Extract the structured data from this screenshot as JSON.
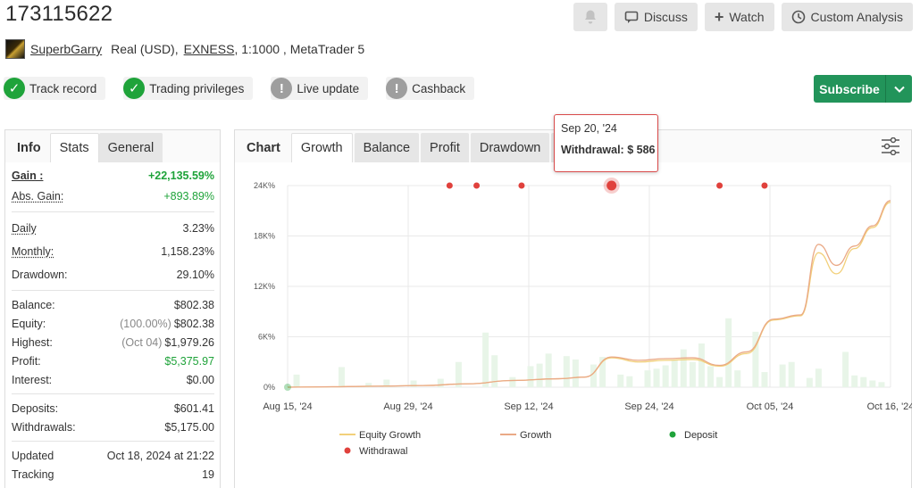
{
  "account": {
    "id": "173115622",
    "owner": "SuperbGarry",
    "type": "Real (USD),",
    "broker": "EXNESS",
    "details": ", 1:1000 , MetaTrader 5"
  },
  "actions": {
    "discuss": "Discuss",
    "watch": "Watch",
    "custom_analysis": "Custom Analysis"
  },
  "badges": [
    {
      "label": "Track record",
      "status": "ok"
    },
    {
      "label": "Trading privileges",
      "status": "ok"
    },
    {
      "label": "Live update",
      "status": "warn"
    },
    {
      "label": "Cashback",
      "status": "warn"
    }
  ],
  "subscribe": {
    "label": "Subscribe"
  },
  "left_tabs": {
    "title": "Info",
    "stats": "Stats",
    "general": "General"
  },
  "stats": {
    "gain": {
      "label": "Gain :",
      "value": "+22,135.59%"
    },
    "abs_gain": {
      "label": "Abs. Gain:",
      "value": "+893.89%"
    },
    "daily": {
      "label": "Daily",
      "value": "3.23%"
    },
    "monthly": {
      "label": "Monthly:",
      "value": "1,158.23%"
    },
    "drawdown": {
      "label": "Drawdown:",
      "value": "29.10%"
    },
    "balance": {
      "label": "Balance:",
      "value": "$802.38"
    },
    "equity": {
      "label": "Equity:",
      "pct": "(100.00%)",
      "value": "$802.38"
    },
    "highest": {
      "label": "Highest:",
      "date": "(Oct 04)",
      "value": "$1,979.26"
    },
    "profit": {
      "label": "Profit:",
      "value": "$5,375.97"
    },
    "interest": {
      "label": "Interest:",
      "value": "$0.00"
    },
    "deposits": {
      "label": "Deposits:",
      "value": "$601.41"
    },
    "withdrawals": {
      "label": "Withdrawals:",
      "value": "$5,175.00"
    },
    "updated": {
      "label": "Updated",
      "value": "Oct 18, 2024 at 21:22"
    },
    "tracking": {
      "label": "Tracking",
      "value": "19"
    }
  },
  "chart_tabs": {
    "title": "Chart",
    "items": [
      "Growth",
      "Balance",
      "Profit",
      "Drawdown"
    ]
  },
  "tooltip": {
    "date": "Sep 20, '24",
    "label": "Withdrawal:",
    "value": "$ 586"
  },
  "colors": {
    "gain_green": "#1fa33a",
    "subscribe": "#22945a",
    "withdrawal": "#e0413c",
    "deposit": "#1fa33a",
    "equity_line": "#f2d07a",
    "growth_line": "#eaa986",
    "bars": "#e8f5e8"
  },
  "chart_data": {
    "type": "line",
    "x_ticks": [
      "Aug 15, '24",
      "Aug 29, '24",
      "Sep 12, '24",
      "Sep 24, '24",
      "Oct 05, '24",
      "Oct 16, '24"
    ],
    "y_ticks": [
      "0%",
      "6K%",
      "12K%",
      "18K%",
      "24K%"
    ],
    "ylim": [
      0,
      24000
    ],
    "xlim_days": [
      0,
      67
    ],
    "grid": true,
    "legend_position": "bottom",
    "series": [
      {
        "name": "Equity Growth",
        "type": "line",
        "x": [
          0,
          5,
          10,
          15,
          20,
          25,
          30,
          33,
          36,
          39,
          42,
          45,
          48,
          51,
          54,
          57,
          59,
          61,
          63,
          65,
          67
        ],
        "values": [
          0,
          50,
          120,
          200,
          400,
          800,
          1000,
          1200,
          3500,
          3000,
          3200,
          3300,
          2500,
          4000,
          8000,
          8500,
          16000,
          13500,
          16500,
          19000,
          22000
        ]
      },
      {
        "name": "Growth",
        "type": "line",
        "x": [
          0,
          5,
          10,
          15,
          20,
          25,
          30,
          33,
          36,
          39,
          42,
          45,
          48,
          51,
          54,
          57,
          59,
          61,
          63,
          65,
          67
        ],
        "values": [
          0,
          50,
          120,
          200,
          400,
          800,
          1000,
          1200,
          3600,
          3200,
          3400,
          3500,
          2600,
          4200,
          8100,
          8600,
          17000,
          14500,
          16800,
          19200,
          22200
        ]
      },
      {
        "name": "Deposit",
        "type": "scatter",
        "x": [
          0
        ],
        "values": [
          0
        ]
      },
      {
        "name": "Withdrawal",
        "type": "scatter",
        "x": [
          18,
          21,
          26,
          36,
          48,
          53
        ],
        "values": [
          24000,
          24000,
          24000,
          24000,
          24000,
          24000
        ]
      }
    ],
    "bars": {
      "x": [
        1,
        6,
        9,
        11,
        14,
        17,
        19,
        22,
        23,
        25,
        27,
        28,
        29,
        31,
        32,
        34,
        35,
        37,
        38,
        40,
        41,
        42,
        43,
        44,
        45,
        46,
        47,
        48,
        49,
        50,
        52,
        53,
        55,
        56,
        58,
        59,
        62,
        63,
        64,
        65,
        66
      ],
      "values": [
        1500,
        2400,
        500,
        900,
        800,
        1000,
        3000,
        6500,
        3800,
        1200,
        2500,
        2800,
        4000,
        3700,
        3300,
        2700,
        3600,
        1500,
        1300,
        2000,
        2200,
        2600,
        3200,
        4500,
        3000,
        5200,
        2500,
        1200,
        8200,
        2000,
        6600,
        1800,
        2700,
        3000,
        1100,
        2200,
        4200,
        1400,
        1200,
        800,
        600
      ]
    }
  }
}
